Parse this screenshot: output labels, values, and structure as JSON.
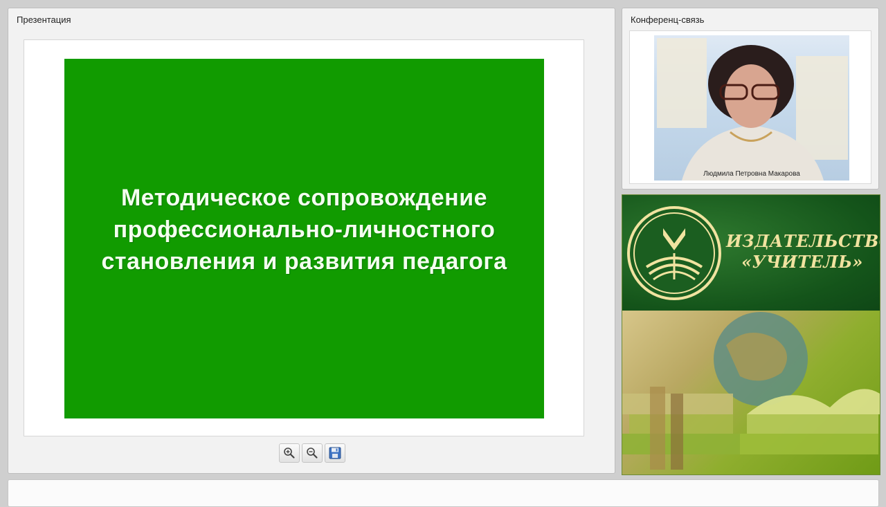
{
  "presentation": {
    "title": "Презентация",
    "slide_text": "Методическое сопровождение\nпрофессионально-личностного\nстановления и развития педагога",
    "slide_color": "#119b00",
    "tools": [
      {
        "icon": "zoom-in-icon"
      },
      {
        "icon": "zoom-out-icon"
      },
      {
        "icon": "save-icon"
      }
    ]
  },
  "conference": {
    "title": "Конференц-связь",
    "speaker_name": "Людмила Петровна Макарова"
  },
  "banner": {
    "publisher_name": "ИЗДАТЕЛЬСТВО\n«УЧИТЕЛЬ»",
    "accent": "#f1e3a0"
  }
}
